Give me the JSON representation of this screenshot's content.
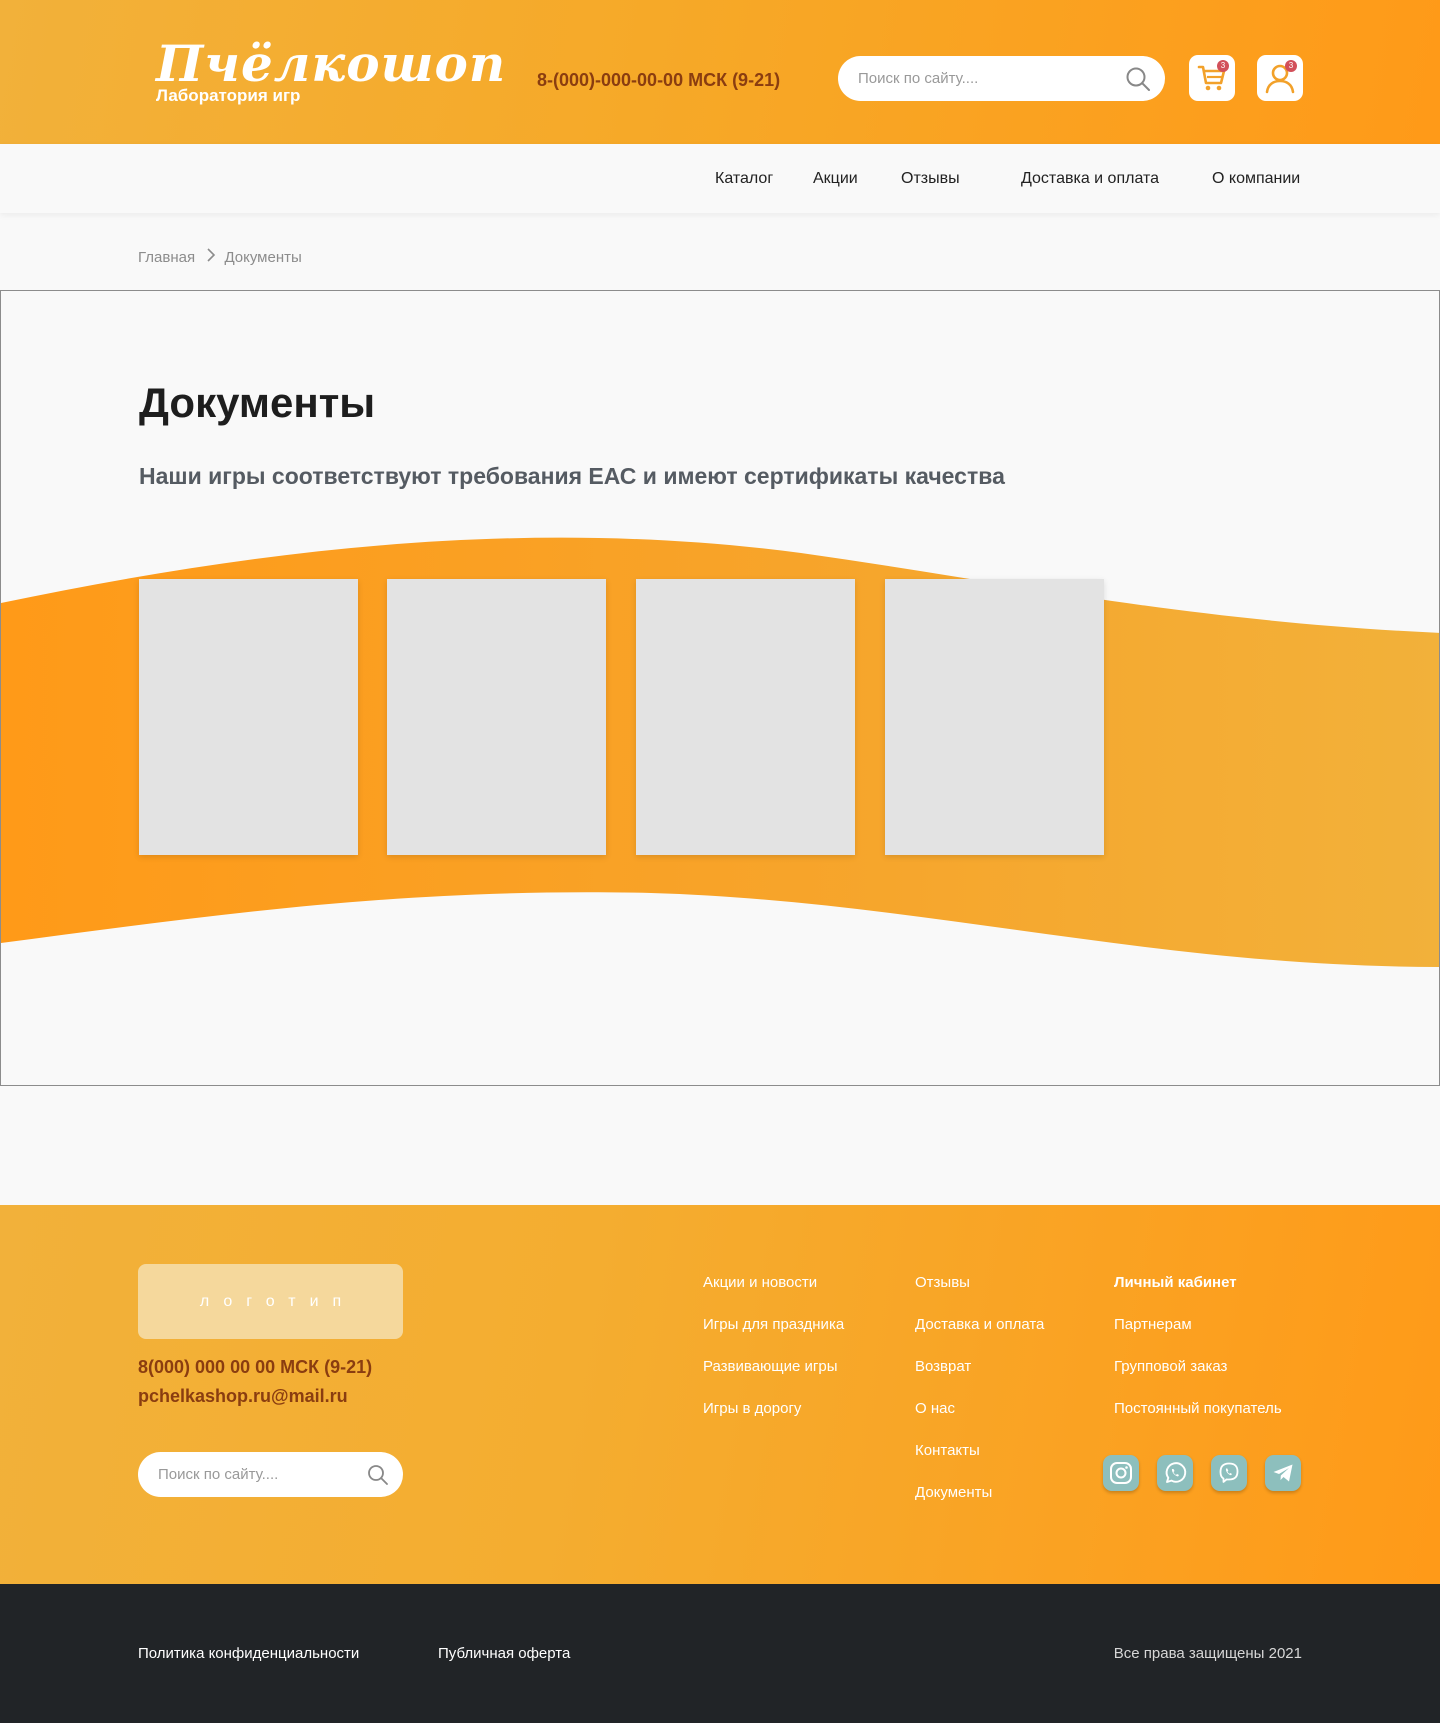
{
  "header": {
    "logo_title": "Пчёлкошоп",
    "logo_subtitle": "Лаборатория игр",
    "phone": "8-(000)-000-00-00 МСК (9-21)",
    "search_placeholder": "Поиск по сайту....",
    "cart_badge": "3",
    "profile_badge": "3"
  },
  "nav": {
    "items": [
      "Каталог",
      "Акции",
      "Отзывы",
      "Доставка и оплата",
      "О компании"
    ]
  },
  "breadcrumb": {
    "home": "Главная",
    "current": "Документы"
  },
  "main": {
    "title": "Документы",
    "subtitle": "Наши игры соответствуют требования ЕАС и имеют сертификаты качества",
    "documents_count": 4
  },
  "footer": {
    "logo_placeholder": "логотип",
    "phone": "8(000) 000 00 00 МСК (9-21)",
    "email": "pchelkashop.ru@mail.ru",
    "search_placeholder": "Поиск по сайту....",
    "col1": [
      "Акции и новости",
      "Игры для праздника",
      "Развивающие игры",
      "Игры в дорогу"
    ],
    "col2": [
      "Отзывы",
      "Доставка и оплата",
      "Возврат",
      "О нас",
      "Контакты",
      "Документы"
    ],
    "col3": [
      "Личный кабинет",
      "Партнерам",
      "Групповой заказ",
      "Постоянный покупатель"
    ],
    "social": [
      "instagram-icon",
      "whatsapp-icon",
      "viber-icon",
      "telegram-icon"
    ]
  },
  "bottom": {
    "privacy": "Политика конфиденциальности",
    "offer": "Публичная оферта",
    "copyright": "Все права защищены 2021"
  },
  "colors": {
    "accent": "#ff9a18",
    "accent_light": "#f2b13a",
    "phone_text": "#8a3d10",
    "footer_bar": "#212427",
    "badge": "#d2505a",
    "social": "#8dbfbd"
  }
}
